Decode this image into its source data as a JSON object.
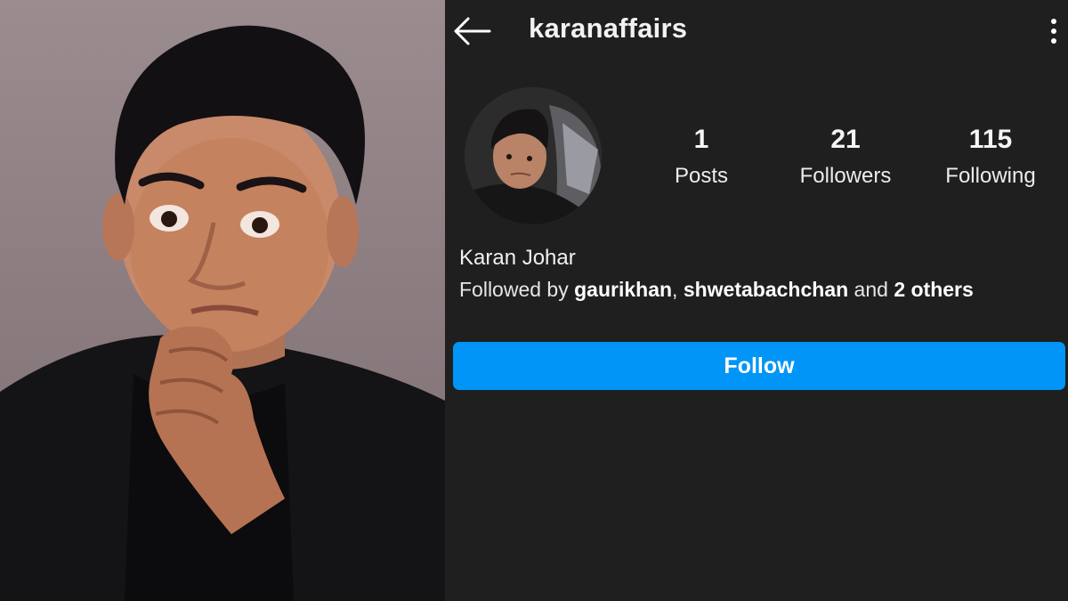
{
  "profile": {
    "username": "karanaffairs",
    "full_name": "Karan Johar",
    "stats": [
      {
        "value": "1",
        "label": "Posts"
      },
      {
        "value": "21",
        "label": "Followers"
      },
      {
        "value": "115",
        "label": "Following"
      }
    ],
    "followed_by": {
      "prefix": "Followed by ",
      "user1": "gaurikhan",
      "sep": ", ",
      "user2": "shwetabachchan",
      "mid": " and ",
      "others": "2 others"
    },
    "follow_label": "Follow"
  },
  "icons": {
    "back": "back-arrow-icon",
    "more": "more-vertical-icon"
  },
  "colors": {
    "background": "#1f1f1f",
    "follow_button": "#0095f6",
    "text": "#ffffff"
  }
}
